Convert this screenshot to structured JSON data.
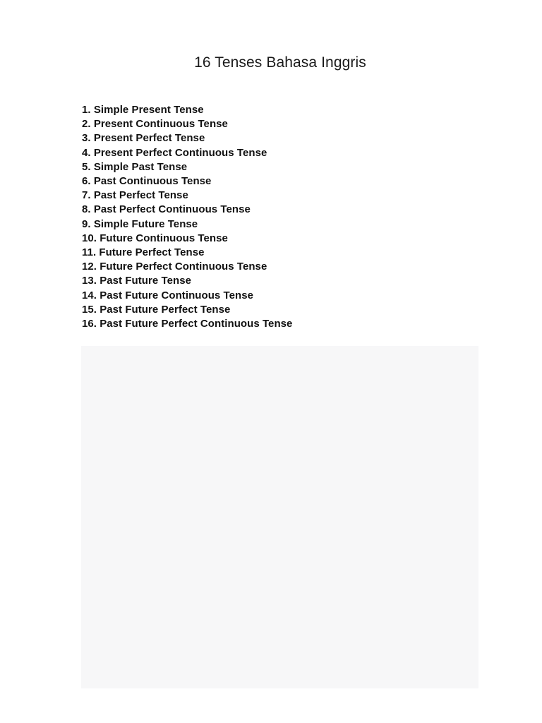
{
  "document": {
    "title": "16 Tenses Bahasa Inggris",
    "background_color": "#ffffff",
    "text_color": "#111111"
  },
  "tense_list": {
    "items": [
      {
        "number": "1.",
        "label": "Simple Present Tense",
        "text": "1. Simple Present Tense"
      },
      {
        "number": "2.",
        "label": "Present Continuous Tense",
        "text": "2. Present Continuous Tense"
      },
      {
        "number": "3.",
        "label": "Present Perfect Tense",
        "text": "3. Present Perfect Tense"
      },
      {
        "number": "4.",
        "label": "Present Perfect Continuous Tense",
        "text": "4. Present Perfect Continuous Tense"
      },
      {
        "number": "5.",
        "label": "Simple Past Tense",
        "text": "5. Simple Past Tense"
      },
      {
        "number": "6.",
        "label": "Past Continuous Tense",
        "text": "6. Past Continuous Tense"
      },
      {
        "number": "7.",
        "label": "Past Perfect Tense",
        "text": "7. Past Perfect Tense"
      },
      {
        "number": "8.",
        "label": "Past Perfect Continuous Tense",
        "text": "8. Past Perfect Continuous Tense"
      },
      {
        "number": "9.",
        "label": "Simple Future Tense",
        "text": "9. Simple Future Tense"
      },
      {
        "number": "10.",
        "label": "Future Continuous Tense",
        "text": "10. Future Continuous Tense"
      },
      {
        "number": "11.",
        "label": "Future Perfect Tense",
        "text": "11. Future Perfect Tense"
      },
      {
        "number": "12.",
        "label": "Future Perfect Continuous Tense",
        "text": "12. Future Perfect Continuous Tense"
      },
      {
        "number": "13.",
        "label": "Past Future Tense",
        "text": "13. Past Future Tense"
      },
      {
        "number": "14.",
        "label": "Past Future Continuous Tense",
        "text": "14. Past Future Continuous Tense"
      },
      {
        "number": "15.",
        "label": "Past Future Perfect Tense",
        "text": "15. Past Future Perfect Tense"
      },
      {
        "number": "16.",
        "label": "Past Future Perfect Continuous Tense",
        "text": "16. Past Future Perfect Continuous Tense"
      }
    ]
  },
  "image_placeholder": {
    "content": "",
    "fill_color": "#f7f7f8"
  }
}
